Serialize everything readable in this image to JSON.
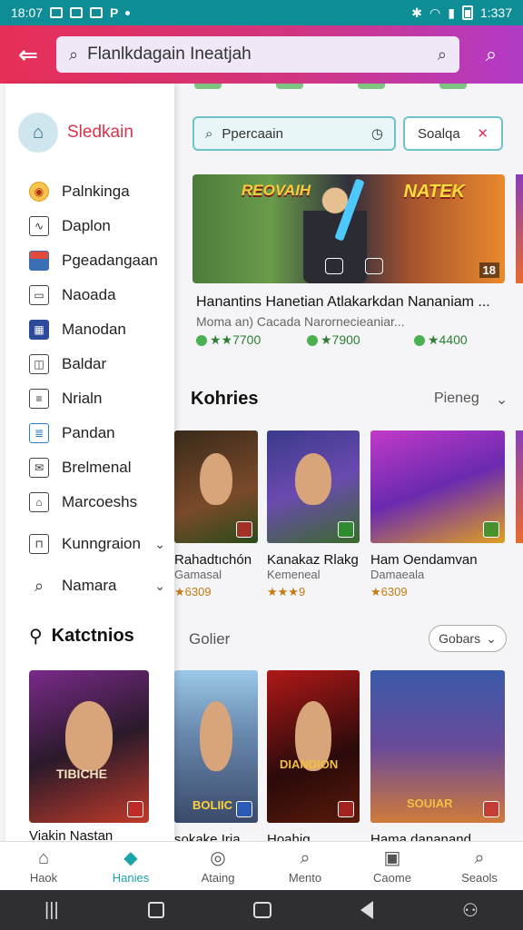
{
  "status_bar": {
    "time": "18:07",
    "right_time": "1:337"
  },
  "header": {
    "search_value": "Flanlkdagain Ineatjah"
  },
  "filters": {
    "search_placeholder": "Ppercaain",
    "filter_label": "Soalqa"
  },
  "hero": {
    "logo_left": "REOVAIH",
    "logo_right": "NATEK",
    "corner_badge": "18",
    "title": "Hanantins Hanetian Atlakarkdan Nananiam ...",
    "subtitle": "Moma an) Cacada Narornecieaniar...",
    "prices": [
      "★★7700",
      "★7900",
      "★4400"
    ]
  },
  "section1": {
    "title": "Kohries",
    "dropdown": "Pieneg"
  },
  "games1": [
    {
      "title": "Rahadtıchón",
      "developer": "Gamasal",
      "rating": "★6309"
    },
    {
      "title": "Kanakaz Rlakg",
      "developer": "Kemeneal",
      "rating": "★★★9"
    },
    {
      "title": "Ham Oendamvan",
      "developer": "Damaeala",
      "rating": "★6309"
    }
  ],
  "section2": {
    "title": "Golier",
    "dropdown": "Gobars"
  },
  "games2": [
    {
      "title": "sokake Iria",
      "art_text": "BOLIIC"
    },
    {
      "title": "Hoahig",
      "art_text": "DIANDION"
    },
    {
      "title": "Hama dananand",
      "art_text": "SOUIAR"
    }
  ],
  "drawer": {
    "title": "Sledkain",
    "items": [
      {
        "label": "Palnkinga",
        "icon": "coin-icon"
      },
      {
        "label": "Daplon",
        "icon": "chart-icon"
      },
      {
        "label": "Pgeadangaan",
        "icon": "calendar-icon"
      },
      {
        "label": "Naoada",
        "icon": "folder-icon"
      },
      {
        "label": "Manodan",
        "icon": "grid-icon"
      },
      {
        "label": "Baldar",
        "icon": "bag-icon"
      },
      {
        "label": "Nrialn",
        "icon": "list-icon"
      },
      {
        "label": "Pandan",
        "icon": "document-icon"
      },
      {
        "label": "Brelmenal",
        "icon": "mail-icon"
      },
      {
        "label": "Marcoeshs",
        "icon": "house-icon"
      },
      {
        "label": "Kunngraion",
        "icon": "basket-icon",
        "expandable": true
      },
      {
        "label": "Namara",
        "icon": "search-icon",
        "expandable": true
      }
    ],
    "category_title": "Katctnios",
    "card_title": "Viakin Nastan",
    "card_art": "TIBICHE"
  },
  "tabs": [
    {
      "label": "Haok",
      "icon": "home-icon"
    },
    {
      "label": "Hanies",
      "icon": "games-icon",
      "active": true
    },
    {
      "label": "Ataing",
      "icon": "rating-icon"
    },
    {
      "label": "Mento",
      "icon": "search-icon"
    },
    {
      "label": "Caome",
      "icon": "news-icon"
    },
    {
      "label": "Seaols",
      "icon": "search-icon"
    }
  ],
  "colors": {
    "accent": "#1aa3a8",
    "header_start": "#e72f57",
    "header_end": "#b23bc7",
    "drawer_title": "#d9344b"
  }
}
